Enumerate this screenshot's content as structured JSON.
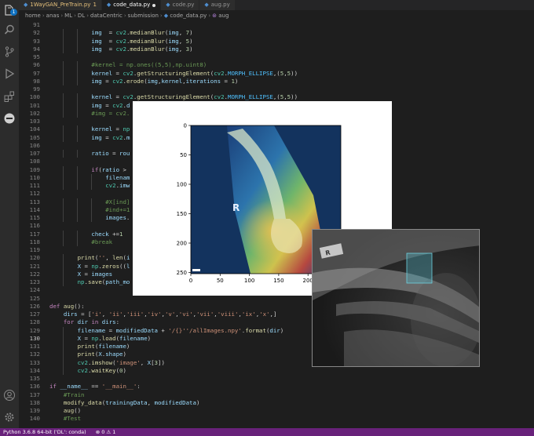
{
  "tabs": [
    {
      "name": "1WayGAN_PreTrain.py",
      "suffix": "1",
      "active": false,
      "modified": false
    },
    {
      "name": "code_data.py",
      "suffix": "",
      "active": true,
      "modified": true
    },
    {
      "name": "code.py",
      "suffix": "",
      "active": false,
      "modified": false
    },
    {
      "name": "aug.py",
      "suffix": "",
      "active": false,
      "modified": false
    }
  ],
  "breadcrumb": [
    "home",
    "anas",
    "ML",
    "DL",
    "dataCentric",
    "submission",
    "code_data.py",
    "aug"
  ],
  "activity": {
    "items": [
      "explorer-icon",
      "search-icon",
      "source-control-icon",
      "run-debug-icon",
      "extensions-icon",
      "remote-icon"
    ],
    "bottom": [
      "account-icon",
      "settings-gear-icon"
    ],
    "badge": "1"
  },
  "editor": {
    "current_line": "130",
    "lines": [
      {
        "n": "91",
        "t": ""
      },
      {
        "n": "92",
        "t": "            img  = cv2.medianBlur(img, 7)"
      },
      {
        "n": "93",
        "t": "            img  = cv2.medianBlur(img, 5)"
      },
      {
        "n": "94",
        "t": "            img  = cv2.medianBlur(img, 3)"
      },
      {
        "n": "95",
        "t": ""
      },
      {
        "n": "96",
        "t": "            #kernel = np.ones((5,5),np.uint8)"
      },
      {
        "n": "97",
        "t": "            kernel = cv2.getStructuringElement(cv2.MORPH_ELLIPSE,(5,5))"
      },
      {
        "n": "98",
        "t": "            img = cv2.erode(img,kernel,iterations = 1)"
      },
      {
        "n": "99",
        "t": ""
      },
      {
        "n": "100",
        "t": "            kernel = cv2.getStructuringElement(cv2.MORPH_ELLIPSE,(5,5))"
      },
      {
        "n": "101",
        "t": "            img = cv2.d"
      },
      {
        "n": "102",
        "t": "            #img = cv2."
      },
      {
        "n": "103",
        "t": ""
      },
      {
        "n": "104",
        "t": "            kernel = np"
      },
      {
        "n": "105",
        "t": "            img = cv2.m"
      },
      {
        "n": "106",
        "t": ""
      },
      {
        "n": "107",
        "t": "            ratio = rou"
      },
      {
        "n": "108",
        "t": ""
      },
      {
        "n": "109",
        "t": "            if(ratio >"
      },
      {
        "n": "110",
        "t": "                filenam"
      },
      {
        "n": "111",
        "t": "                cv2.imw"
      },
      {
        "n": "112",
        "t": ""
      },
      {
        "n": "113",
        "t": "                #X[ind]"
      },
      {
        "n": "114",
        "t": "                #ind+=1"
      },
      {
        "n": "115",
        "t": "                images."
      },
      {
        "n": "116",
        "t": ""
      },
      {
        "n": "117",
        "t": "            check +=1"
      },
      {
        "n": "118",
        "t": "            #break"
      },
      {
        "n": "119",
        "t": ""
      },
      {
        "n": "120",
        "t": "        print('', len(i"
      },
      {
        "n": "121",
        "t": "        X = np.zeros((l"
      },
      {
        "n": "122",
        "t": "        X = images"
      },
      {
        "n": "123",
        "t": "        np.save(path_mo"
      },
      {
        "n": "124",
        "t": ""
      },
      {
        "n": "125",
        "t": ""
      },
      {
        "n": "126",
        "t": "def aug():"
      },
      {
        "n": "127",
        "t": "    dirs = ['i', 'ii','iii','iv','v','vi','vii','viii','ix','x',]"
      },
      {
        "n": "128",
        "t": "    for dir in dirs:"
      },
      {
        "n": "129",
        "t": "        filename = modifiedData + '/{}''/allImages.npy'.format(dir)"
      },
      {
        "n": "130",
        "t": "        X = np.load(filename)"
      },
      {
        "n": "131",
        "t": "        print(filename)"
      },
      {
        "n": "132",
        "t": "        print(X.shape)"
      },
      {
        "n": "133",
        "t": "        cv2.imshow('image', X[3])"
      },
      {
        "n": "134",
        "t": "        cv2.waitKey(0)"
      },
      {
        "n": "135",
        "t": ""
      },
      {
        "n": "136",
        "t": "if __name__ == '__main__':"
      },
      {
        "n": "137",
        "t": "    #Train"
      },
      {
        "n": "138",
        "t": "    modify_data(trainingData, modifiedData)"
      },
      {
        "n": "139",
        "t": "    aug()"
      },
      {
        "n": "140",
        "t": "    #Test"
      }
    ]
  },
  "plot": {
    "yticks": [
      "0",
      "50",
      "100",
      "150",
      "200",
      "250"
    ],
    "xticks": [
      "0",
      "50",
      "100",
      "150",
      "200"
    ],
    "marker_letter": "R"
  },
  "xray": {
    "marker_letter": "R"
  },
  "statusbar": {
    "interpreter": "Python 3.6.8 64-bit ('DL': conda)",
    "problems": "⊗ 0 ⚠ 1"
  },
  "colors": {
    "statusbar": "#68217a",
    "editor_bg": "#1e1e1e",
    "activity_bg": "#2c2c2c"
  }
}
